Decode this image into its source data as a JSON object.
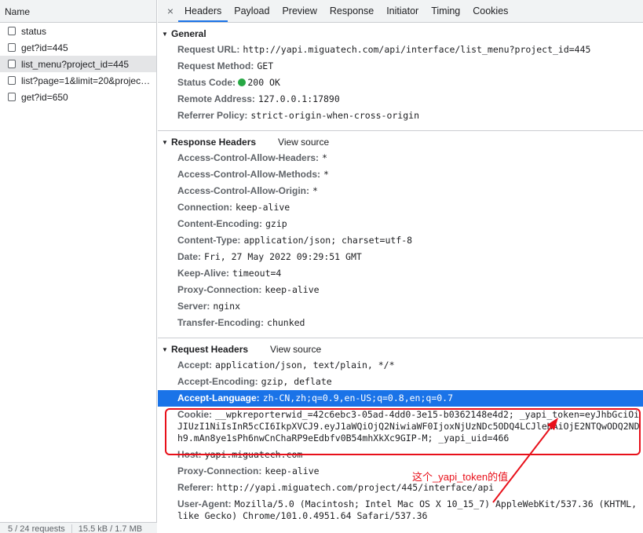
{
  "left": {
    "header": "Name",
    "requests": [
      {
        "name": "status",
        "selected": false
      },
      {
        "name": "get?id=445",
        "selected": false
      },
      {
        "name": "list_menu?project_id=445",
        "selected": true
      },
      {
        "name": "list?page=1&limit=20&projec…",
        "selected": false
      },
      {
        "name": "get?id=650",
        "selected": false
      }
    ],
    "footer_requests": "5 / 24 requests",
    "footer_size": "15.5 kB / 1.7 MB"
  },
  "tabs": {
    "close": "×",
    "items": [
      "Headers",
      "Payload",
      "Preview",
      "Response",
      "Initiator",
      "Timing",
      "Cookies"
    ],
    "active": "Headers"
  },
  "general": {
    "title": "General",
    "rows": [
      {
        "key": "Request URL:",
        "value": "http://yapi.miguatech.com/api/interface/list_menu?project_id=445"
      },
      {
        "key": "Request Method:",
        "value": "GET"
      },
      {
        "key": "Status Code:",
        "value": "200 OK"
      },
      {
        "key": "Remote Address:",
        "value": "127.0.0.1:17890"
      },
      {
        "key": "Referrer Policy:",
        "value": "strict-origin-when-cross-origin"
      }
    ]
  },
  "response_headers": {
    "title": "Response Headers",
    "view_source": "View source",
    "rows": [
      {
        "key": "Access-Control-Allow-Headers:",
        "value": "*"
      },
      {
        "key": "Access-Control-Allow-Methods:",
        "value": "*"
      },
      {
        "key": "Access-Control-Allow-Origin:",
        "value": "*"
      },
      {
        "key": "Connection:",
        "value": "keep-alive"
      },
      {
        "key": "Content-Encoding:",
        "value": "gzip"
      },
      {
        "key": "Content-Type:",
        "value": "application/json; charset=utf-8"
      },
      {
        "key": "Date:",
        "value": "Fri, 27 May 2022 09:29:51 GMT"
      },
      {
        "key": "Keep-Alive:",
        "value": "timeout=4"
      },
      {
        "key": "Proxy-Connection:",
        "value": "keep-alive"
      },
      {
        "key": "Server:",
        "value": "nginx"
      },
      {
        "key": "Transfer-Encoding:",
        "value": "chunked"
      }
    ]
  },
  "request_headers": {
    "title": "Request Headers",
    "view_source": "View source",
    "rows": [
      {
        "key": "Accept:",
        "value": "application/json, text/plain, */*"
      },
      {
        "key": "Accept-Encoding:",
        "value": "gzip, deflate"
      },
      {
        "key": "Accept-Language:",
        "value": "zh-CN,zh;q=0.9,en-US;q=0.8,en;q=0.7"
      },
      {
        "key": "Cookie:",
        "value": "__wpkreporterwid_=42c6ebc3-05ad-4dd0-3e15-b0362148e4d2; _yapi_token=eyJhbGciOiJIUzI1NiIsInR5cCI6IkpXVCJ9.eyJ1aWQiOjQ2NiwiaWF0IjoxNjUzNDc5ODQ4LCJleHAiOjE2NTQwODQ2NDh9.mAn8ye1sPh6nwCnChaRP9eEdbfv0B54mhXkXc9GIP-M; _yapi_uid=466"
      },
      {
        "key": "Host:",
        "value": "yapi.miguatech.com"
      },
      {
        "key": "Proxy-Connection:",
        "value": "keep-alive"
      },
      {
        "key": "Referer:",
        "value": "http://yapi.miguatech.com/project/445/interface/api"
      },
      {
        "key": "User-Agent:",
        "value": "Mozilla/5.0 (Macintosh; Intel Mac OS X 10_15_7) AppleWebKit/537.36 (KHTML, like Gecko) Chrome/101.0.4951.64 Safari/537.36"
      }
    ]
  },
  "annotation": {
    "text": "这个_yapi_token的值",
    "color": "#e8101a"
  },
  "colors": {
    "accent": "#1a73e8",
    "status_ok": "#27a844"
  }
}
